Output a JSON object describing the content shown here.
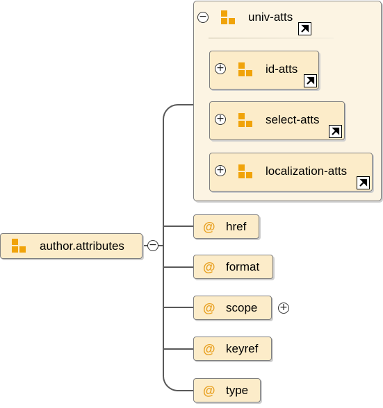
{
  "root": {
    "label": "author.attributes",
    "collapse_symbol": "−"
  },
  "group": {
    "label": "univ-atts",
    "collapse_symbol": "−",
    "children": [
      {
        "label": "id-atts",
        "expand_symbol": "+"
      },
      {
        "label": "select-atts",
        "expand_symbol": "+"
      },
      {
        "label": "localization-atts",
        "expand_symbol": "+"
      }
    ]
  },
  "attributes": [
    {
      "symbol": "@",
      "label": "href"
    },
    {
      "symbol": "@",
      "label": "format"
    },
    {
      "symbol": "@",
      "label": "scope",
      "expand_symbol": "+"
    },
    {
      "symbol": "@",
      "label": "keyref"
    },
    {
      "symbol": "@",
      "label": "type"
    }
  ],
  "icons": {
    "group": "attribute-group-icon",
    "attribute": "attribute-at-icon",
    "link": "external-link-icon"
  },
  "colors": {
    "box_fill": "#fcecc9",
    "group_fill": "#fcf4e3",
    "icon_orange": "#f0a30a",
    "at_color": "#e8a020",
    "border": "#7f7f7f",
    "connector": "#595959"
  }
}
